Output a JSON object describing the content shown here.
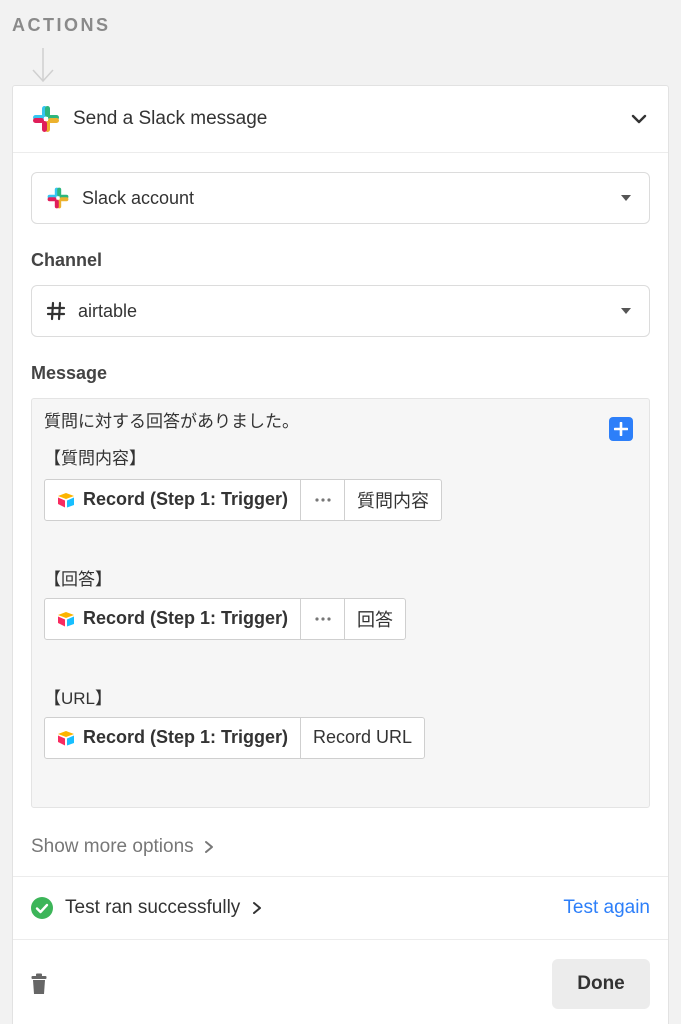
{
  "section": {
    "label": "ACTIONS"
  },
  "action": {
    "title": "Send a Slack message"
  },
  "account": {
    "value": "Slack account"
  },
  "channel": {
    "label": "Channel",
    "value": "airtable"
  },
  "message": {
    "label": "Message",
    "intro": "質問に対する回答がありました。",
    "blocks": [
      {
        "heading": "【質問内容】",
        "source": "Record (Step 1: Trigger)",
        "dots": "•••",
        "field": "質問内容"
      },
      {
        "heading": "【回答】",
        "source": "Record (Step 1: Trigger)",
        "dots": "•••",
        "field": "回答"
      },
      {
        "heading": "【URL】",
        "source": "Record (Step 1: Trigger)",
        "field": "Record URL"
      }
    ]
  },
  "options": {
    "show_more": "Show more options"
  },
  "test": {
    "status": "Test ran successfully",
    "again": "Test again"
  },
  "footer": {
    "done": "Done"
  },
  "colors": {
    "accent": "#2d7ff9",
    "success": "#3cb559"
  }
}
